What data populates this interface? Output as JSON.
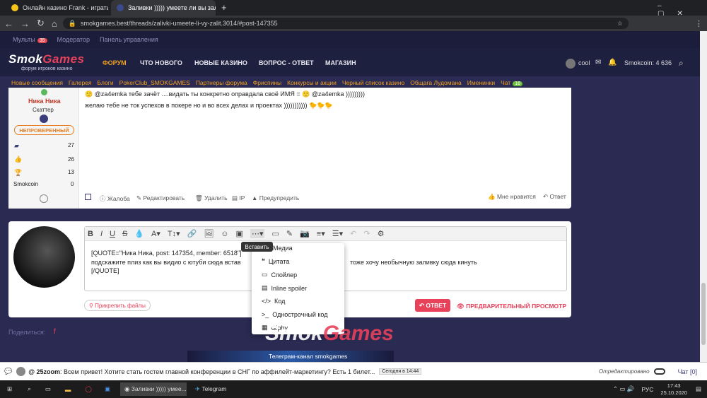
{
  "browser": {
    "tabs": [
      {
        "label": "Онлайн казино Frank - играть н"
      },
      {
        "label": "Заливки ))))) умеете ли вы зали"
      }
    ],
    "url": "smokgames.best/threads/zalivki-umeete-li-vy-zalit.3014/#post-147355"
  },
  "sitebar": {
    "multi": "Мульты",
    "multi_count": "35",
    "moderator": "Модератор",
    "panel": "Панель управления"
  },
  "header": {
    "logo_a": "Smok",
    "logo_b": "Games",
    "logo_sub": "форум игроков казино",
    "nav": [
      "ФОРУМ",
      "ЧТО НОВОГО",
      "НОВЫЕ КАЗИНО",
      "ВОПРОС - ОТВЕТ",
      "МАГАЗИН"
    ],
    "user": "cool",
    "smokcoin": "Smokcoin: 4 636"
  },
  "subnav": [
    "Новые сообщения",
    "Галерея",
    "Блоги",
    "PokerClub_SMOKGAMES",
    "Партнеры форума",
    "Фриспины",
    "Конкурсы и акции",
    "Черный список казино",
    "Общага Лудомана",
    "Именинки",
    "Чат"
  ],
  "subnav_chat_count": "16",
  "post": {
    "author": "Ника Ника",
    "role": "Скаттер",
    "status": "НЕПРОВЕРЕННЫЙ",
    "stats": [
      "27",
      "26",
      "13",
      "0"
    ],
    "smokcoin_label": "Smokcoin",
    "line1": "@za4emka тебе зачёт ....видать ты конкретно оправдала своё ИМЯ = ",
    "line1b": "@za4emka )))))))))",
    "line2": "желаю тебе не ток успехов в покере но и во всех делах и проектах )))))))))))",
    "actions": [
      "Жалоба",
      "Редактировать",
      "Удалить",
      "IP",
      "Предупредить"
    ],
    "like": "Мне нравится",
    "reply": "Ответ"
  },
  "editor": {
    "line1": "[QUOTE=\"Ника Ника, post: 147354, member: 6518\"]",
    "line2a": "подскажите плиз как вы видио с ютуби сюда встав",
    "line2b": "тоже хочу необычную заливку сюда кинуть",
    "line3": "[/QUOTE]",
    "tooltip": "Вставить",
    "menu": [
      "Медиа",
      "Цитата",
      "Спойлер",
      "Inline spoiler",
      "Код",
      "Однострочный код",
      "Giphy"
    ],
    "attach": "Прикрепить файлы",
    "reply": "ОТВЕТ",
    "preview": "ПРЕДВАРИТЕЛЬНЫЙ ПРОСМОТР"
  },
  "footer": {
    "share": "Поделиться:",
    "telegram": "Телеграм-канал smokgames"
  },
  "chat": {
    "user": "@ 25zoom",
    "message": ": Всем привет! Хотите стать гостем главной конференции в СНГ по аффилейт-маркетингу? Есть 1 билет...",
    "time": "Сегодня в 14:44",
    "edited": "Отредактировано",
    "chat_label": "Чат [0]"
  },
  "taskbar": {
    "app1": "Заливки ))))) умее...",
    "app2": "Telegram",
    "lang": "РУС",
    "time": "17:43",
    "date": "25.10.2020"
  }
}
